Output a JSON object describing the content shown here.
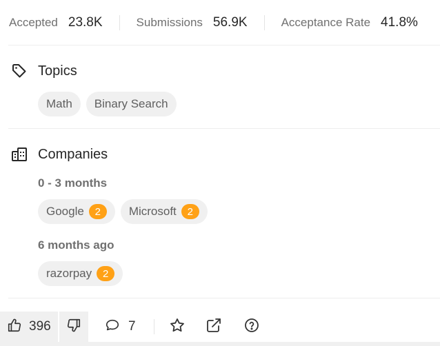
{
  "stats": [
    {
      "label": "Accepted",
      "value": "23.8K"
    },
    {
      "label": "Submissions",
      "value": "56.9K"
    },
    {
      "label": "Acceptance Rate",
      "value": "41.8%"
    }
  ],
  "topics": {
    "title": "Topics",
    "icon": "tag-icon",
    "tags": [
      "Math",
      "Binary Search"
    ]
  },
  "companies": {
    "title": "Companies",
    "icon": "building-icon",
    "groups": [
      {
        "period": "0 - 3 months",
        "items": [
          {
            "name": "Google",
            "count": "2"
          },
          {
            "name": "Microsoft",
            "count": "2"
          }
        ]
      },
      {
        "period": "6 months ago",
        "items": [
          {
            "name": "razorpay",
            "count": "2"
          }
        ]
      }
    ]
  },
  "footer": {
    "likes": "396",
    "comments": "7",
    "icons": [
      "thumbs-up-icon",
      "thumbs-down-icon",
      "comment-icon",
      "star-icon",
      "share-icon",
      "help-icon"
    ]
  },
  "colors": {
    "badge": "#ffa116",
    "chip_bg": "#f0f0f0",
    "muted_text": "#707070"
  }
}
